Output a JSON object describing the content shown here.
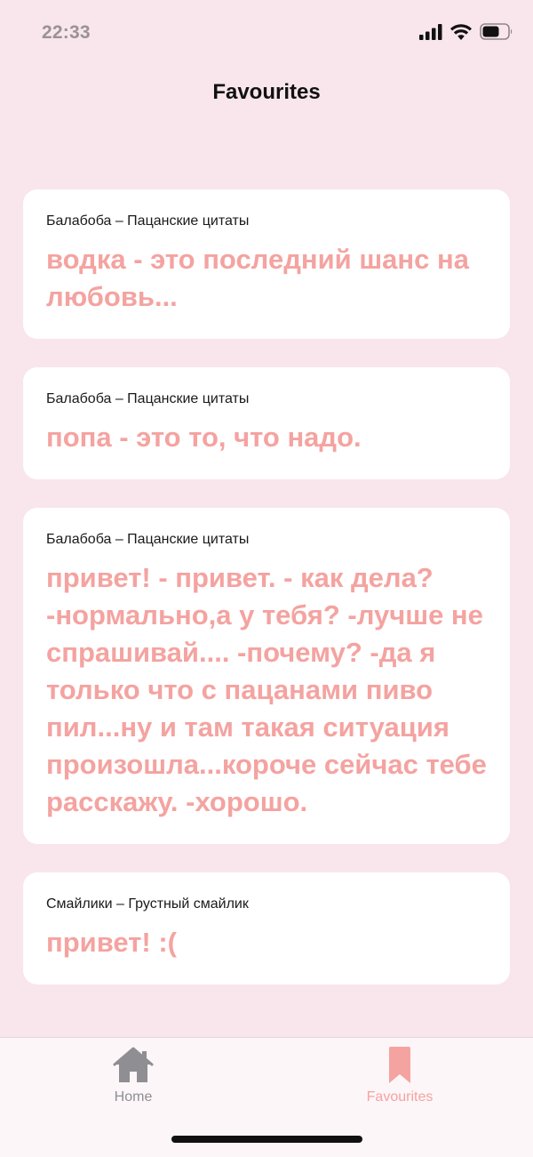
{
  "status_bar": {
    "time": "22:33"
  },
  "nav": {
    "title": "Favourites"
  },
  "favourites": [
    {
      "source": "Балабоба – Пацанские цитаты",
      "text": "водка - это последний шанс на любовь..."
    },
    {
      "source": "Балабоба – Пацанские цитаты",
      "text": "попа - это то, что надо."
    },
    {
      "source": "Балабоба – Пацанские цитаты",
      "text": "привет! - привет. - как дела? -нормально,а у тебя? -лучше не спрашивай.... -почему? -да я только что с пацанами пиво пил...ну и там такая ситуация произошла...короче сейчас тебе расскажу. -хорошо."
    },
    {
      "source": "Смайлики – Грустный смайлик",
      "text": "привет! :("
    }
  ],
  "tab_bar": {
    "tabs": [
      {
        "label": "Home",
        "icon": "house-icon"
      },
      {
        "label": "Favourites",
        "icon": "bookmark-icon",
        "selected": true
      }
    ]
  },
  "colors": {
    "background": "#f8e6ec",
    "accent": "#f4a3a0",
    "inactive_tab": "#8e8e93"
  }
}
